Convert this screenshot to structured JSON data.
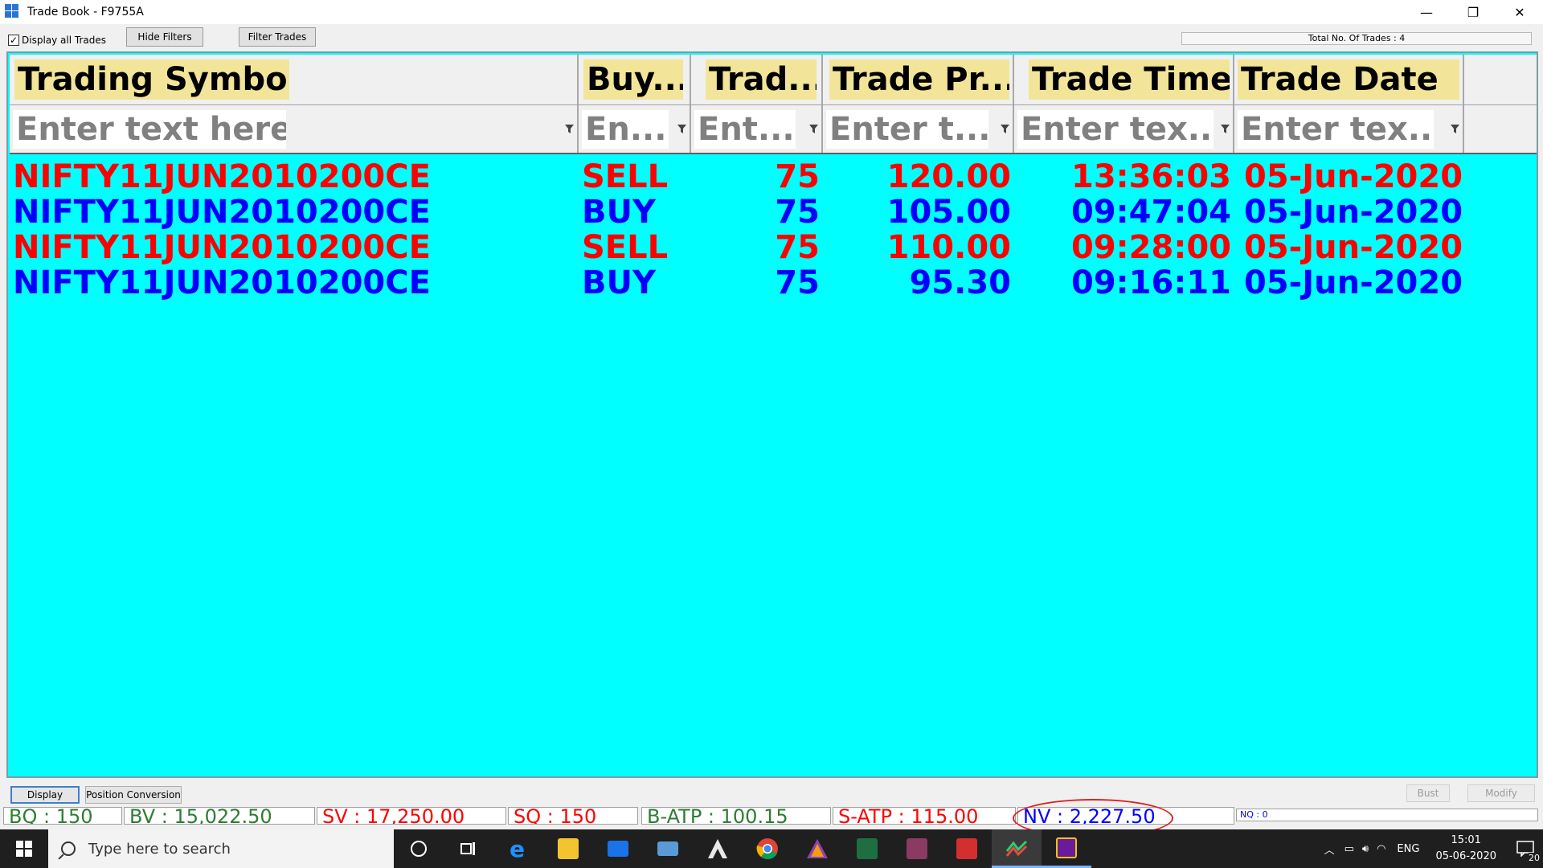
{
  "window": {
    "title": "Trade Book - F9755A",
    "controls": [
      "—",
      "❐",
      "✕"
    ]
  },
  "toolbar": {
    "display_all_label": "Display all Trades",
    "display_all_checked": true,
    "hide_filters_label": "Hide Filters",
    "filter_trades_label": "Filter Trades",
    "total_trades": "Total No. Of Trades : 4"
  },
  "grid": {
    "background": "#00ffff",
    "columns": [
      {
        "header": "Trading Symbol",
        "filter": "Enter text here"
      },
      {
        "header": "Buy...",
        "filter": "En..."
      },
      {
        "header": "Trad...",
        "filter": "Ent..."
      },
      {
        "header": "Trade Pr...",
        "filter": "Enter t..."
      },
      {
        "header": "Trade Time",
        "filter": "Enter tex..."
      },
      {
        "header": "Trade Date",
        "filter": "Enter tex..."
      }
    ],
    "rows": [
      {
        "side_class": "sell",
        "symbol": "NIFTY11JUN2010200CE",
        "side": "SELL",
        "qty": "75",
        "price": "120.00",
        "time": "13:36:03",
        "date": "05-Jun-2020"
      },
      {
        "side_class": "buy",
        "symbol": "NIFTY11JUN2010200CE",
        "side": "BUY",
        "qty": "75",
        "price": "105.00",
        "time": "09:47:04",
        "date": "05-Jun-2020"
      },
      {
        "side_class": "sell",
        "symbol": "NIFTY11JUN2010200CE",
        "side": "SELL",
        "qty": "75",
        "price": "110.00",
        "time": "09:28:00",
        "date": "05-Jun-2020"
      },
      {
        "side_class": "buy",
        "symbol": "NIFTY11JUN2010200CE",
        "side": "BUY",
        "qty": "75",
        "price": "95.30",
        "time": "09:16:11",
        "date": "05-Jun-2020"
      }
    ],
    "sell_color": "#ff0000",
    "buy_color": "#0000ff"
  },
  "bottom": {
    "display_label": "Display",
    "position_conversion_label": "Position Conversion",
    "bust_label": "Bust",
    "modify_label": "Modify"
  },
  "summary": {
    "bq": "BQ : 150",
    "bv": "BV : 15,022.50",
    "sv": "SV : 17,250.00",
    "sq": "SQ : 150",
    "batp": "B-ATP : 100.15",
    "satp": "S-ATP : 115.00",
    "nv": "NV : 2,227.50",
    "nq": "NQ : 0"
  },
  "taskbar": {
    "search_placeholder": "Type here to search",
    "language": "ENG",
    "time": "15:01",
    "date": "05-06-2020",
    "notification_count": "20",
    "pinned_icons": [
      "cortana-icon",
      "task-view-icon",
      "edge-icon",
      "file-explorer-icon",
      "mail-icon",
      "laptop-app-icon",
      "trading-arrow-icon",
      "chrome-icon",
      "prism-app-icon",
      "excel-icon",
      "winrar-icon",
      "acrobat-icon",
      "trading-terminal-icon",
      "odin-app-icon"
    ]
  }
}
